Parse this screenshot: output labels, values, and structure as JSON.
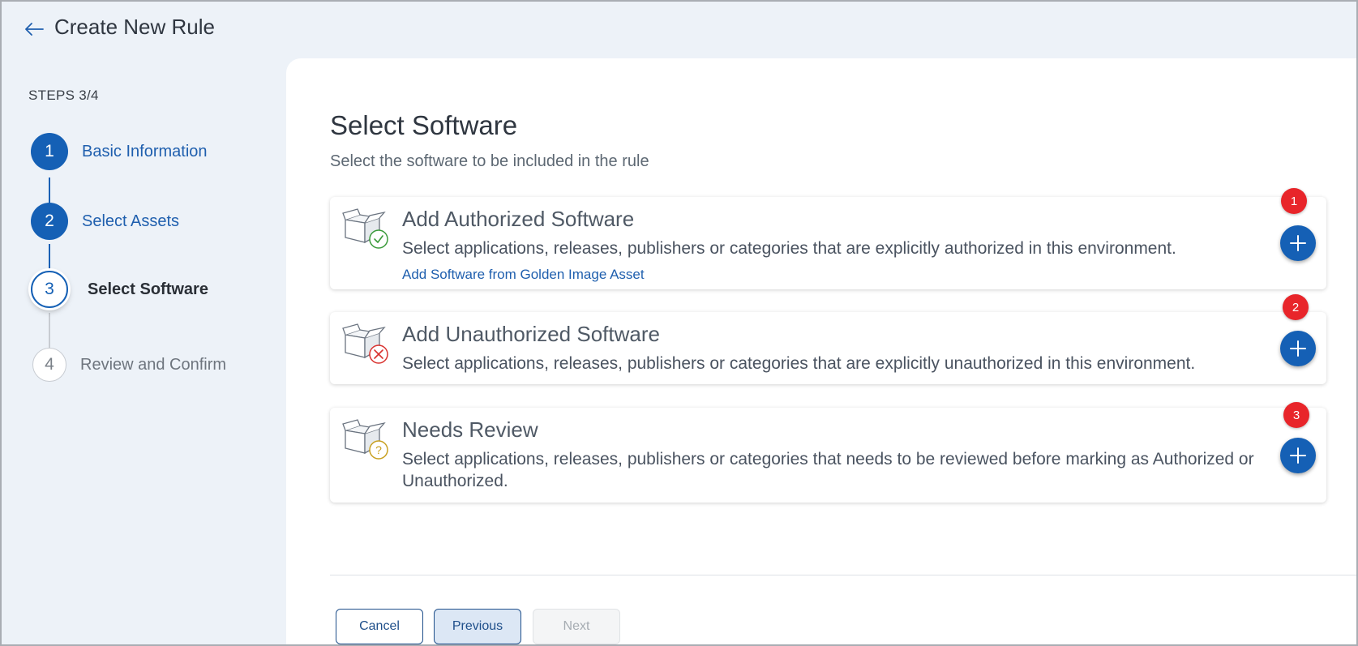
{
  "header": {
    "title": "Create New Rule",
    "back_icon": "arrow-left-icon"
  },
  "sidebar": {
    "steps_label": "STEPS 3/4",
    "steps": [
      {
        "number": "1",
        "label": "Basic Information",
        "state": "done"
      },
      {
        "number": "2",
        "label": "Select Assets",
        "state": "done"
      },
      {
        "number": "3",
        "label": "Select Software",
        "state": "active"
      },
      {
        "number": "4",
        "label": "Review and Confirm",
        "state": "pending"
      }
    ]
  },
  "main": {
    "title": "Select Software",
    "subtitle": "Select the software to be included in the rule",
    "cards": [
      {
        "title": "Add Authorized Software",
        "description": "Select applications, releases, publishers or categories that are explicitly authorized in this environment.",
        "link": "Add Software from Golden Image Asset",
        "badge": "1",
        "icon": "box-check-icon"
      },
      {
        "title": "Add Unauthorized Software",
        "description": "Select applications, releases, publishers or categories that are explicitly unauthorized in this environment.",
        "badge": "2",
        "icon": "box-x-icon"
      },
      {
        "title": "Needs Review",
        "description": "Select applications, releases, publishers or categories that needs to be reviewed before marking as Authorized or Unauthorized.",
        "badge": "3",
        "icon": "box-question-icon"
      }
    ]
  },
  "footer": {
    "cancel_label": "Cancel",
    "previous_label": "Previous",
    "next_label": "Next"
  },
  "colors": {
    "primary": "#1560b5",
    "badge": "#e8252a",
    "background": "#edf2f8",
    "check": "#3a9a3a",
    "error": "#d9322f",
    "warning": "#c8a020"
  }
}
